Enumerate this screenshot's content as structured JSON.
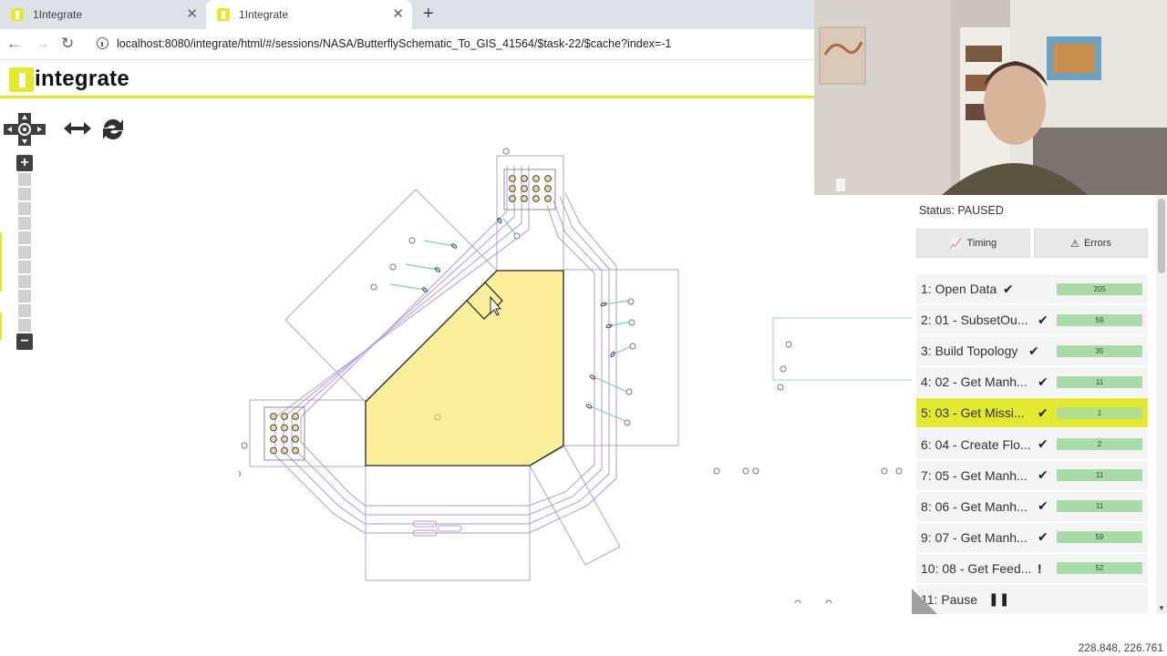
{
  "browser": {
    "tabs": [
      {
        "title": "1Integrate"
      },
      {
        "title": "1Integrate"
      }
    ],
    "url": "localhost:8080/integrate/html/#/sessions/NASA/ButterflySchematic_To_GIS_41564/$task-22/$cache?index=-1"
  },
  "app": {
    "logo_text": "integrate",
    "accent": "#e3e831"
  },
  "map_controls": {
    "pan_icon": "pan-cross-icon",
    "fit_icon": "horizontal-arrows-icon",
    "refresh_icon": "refresh-icon",
    "zoom_in": "+",
    "zoom_out": "−"
  },
  "panel": {
    "status": "Status: PAUSED",
    "timing_label": "Timing",
    "errors_label": "Errors",
    "tasks": [
      {
        "label": "1: Open Data",
        "state": "✔",
        "count": "205"
      },
      {
        "label": "2: 01 - SubsetOu...",
        "state": "✔",
        "count": "59"
      },
      {
        "label": "3: Build Topology",
        "state": "✔",
        "count": "35"
      },
      {
        "label": "4: 02 - Get Manh...",
        "state": "✔",
        "count": "11"
      },
      {
        "label": "5: 03 - Get Missi...",
        "state": "✔",
        "count": "1"
      },
      {
        "label": "6: 04 - Create Flo...",
        "state": "✔",
        "count": "2"
      },
      {
        "label": "7: 05 - Get Manh...",
        "state": "✔",
        "count": "11"
      },
      {
        "label": "8: 06 - Get Manh...",
        "state": "✔",
        "count": "11"
      },
      {
        "label": "9: 07 - Get Manh...",
        "state": "✔",
        "count": "59"
      },
      {
        "label": "10: 08 - Get Feed...",
        "state": "!",
        "count": "52"
      },
      {
        "label": "11: Pause",
        "state": "❚❚",
        "count": ""
      }
    ],
    "active_index": 4
  },
  "coords": "228.848, 226.761"
}
